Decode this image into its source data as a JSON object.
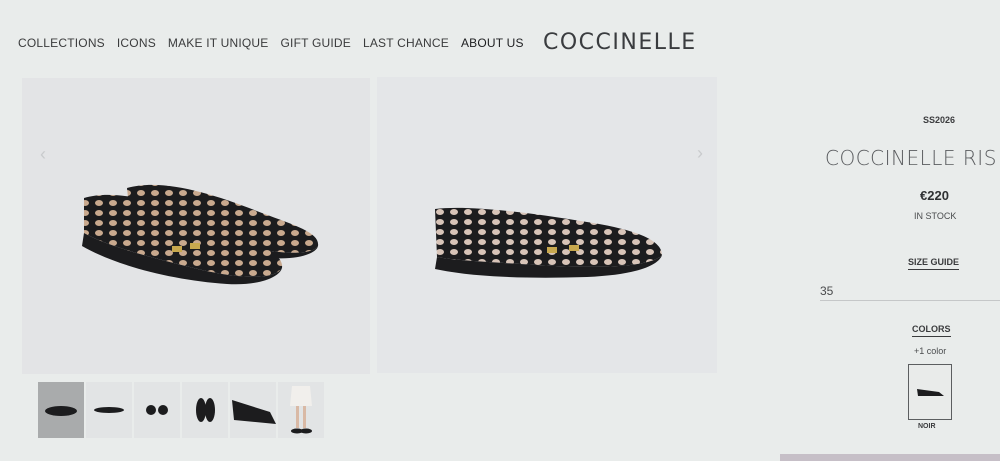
{
  "nav": {
    "items": [
      "COLLECTIONS",
      "ICONS",
      "MAKE IT UNIQUE",
      "GIFT GUIDE",
      "LAST CHANCE",
      "ABOUT US"
    ],
    "brand": "COCCINELLE"
  },
  "product": {
    "season": "SS2026",
    "name": "COCCINELLE RIS",
    "price": "€220",
    "stock": "IN STOCK",
    "size_guide_label": "SIZE GUIDE",
    "size_value": "35",
    "colors_label": "COLORS",
    "more_colors": "+1 color",
    "swatch_label": "NOIR"
  },
  "gallery": {
    "thumbnail_count": 6,
    "selected_thumbnail": 1
  },
  "colors": {
    "shoe": "#1c1c1e",
    "background": "#e9eceb"
  }
}
